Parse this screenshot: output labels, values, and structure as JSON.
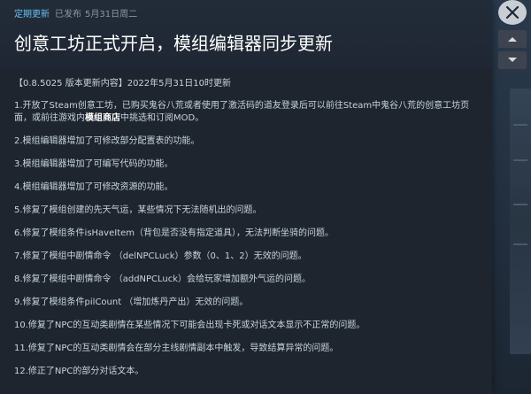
{
  "header": {
    "tag": "定期更新",
    "status": "已发布",
    "date": "5月31日周二",
    "title": "创意工坊正式开启，模组编辑器同步更新"
  },
  "content": {
    "intro": "【0.8.5025 版本更新内容】2022年5月31日10时更新",
    "item1_before": "1.开放了Steam创意工坊，已购买鬼谷八荒或者使用了激活码的道友登录后可以前往Steam中鬼谷八荒的创意工坊页面，或前往游戏内",
    "item1_bold": "模组商店",
    "item1_after": "中挑选和订阅MOD。",
    "items": [
      "2.模组编辑器增加了可修改部分配置表的功能。",
      "3.模组编辑器增加了可编写代码的功能。",
      "4.模组编辑器增加了可修改资源的功能。",
      "5.修复了模组创建的先天气运，某些情况下无法随机出的问题。",
      "6.修复了模组条件isHaveItem（背包是否没有指定道具），无法判断坐骑的问题。",
      "7.修复了模组中剧情命令 （delNPCLuck）参数（0、1、2）无效的问题。",
      "8.修复了模组中剧情命令 （addNPCLuck）会给玩家增加额外气运的问题。",
      "9.修复了模组条件pilCount （增加炼丹产出）无效的问题。",
      "10.修复了NPC的互动类剧情在某些情况下可能会出现卡死或对话文本显示不正常的问题。",
      "11.修复了NPC的互动类剧情会在部分主线剧情副本中触发，导致结算异常的问题。",
      "12.修正了NPC的部分对话文本。"
    ]
  },
  "controls": {
    "close": "close-icon",
    "prev": "chevron-up-icon",
    "next": "chevron-down-icon"
  },
  "colors": {
    "accent": "#66c0f4",
    "panel": "#1f252e",
    "text": "#c6d4df"
  }
}
